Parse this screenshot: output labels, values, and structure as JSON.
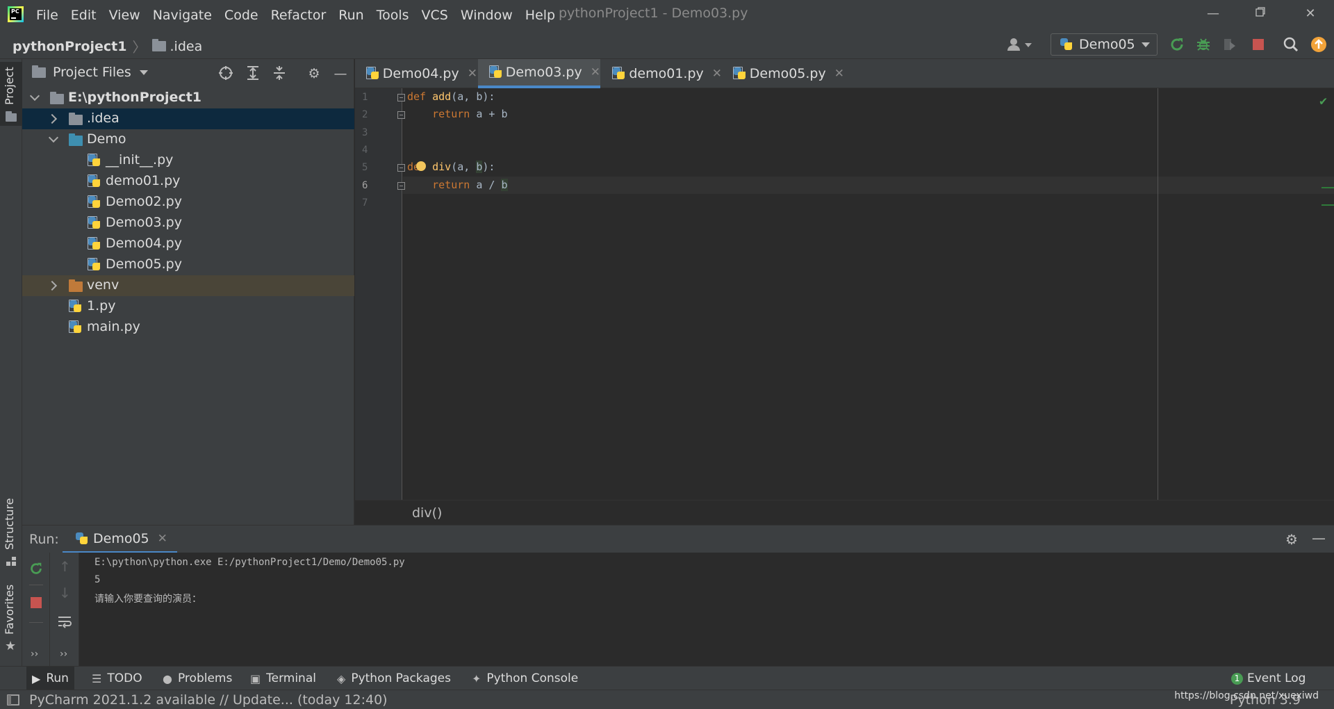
{
  "app": {
    "logo_text": "PC",
    "window_title": "pythonProject1 - Demo03.py",
    "menu": [
      "File",
      "Edit",
      "View",
      "Navigate",
      "Code",
      "Refactor",
      "Run",
      "Tools",
      "VCS",
      "Window",
      "Help"
    ]
  },
  "navbar": {
    "project": "pythonProject1",
    "folder": ".idea",
    "run_config": "Demo05"
  },
  "sidebar_tabs": {
    "project": "Project",
    "structure": "Structure",
    "favorites": "Favorites"
  },
  "project_panel": {
    "title": "Project Files",
    "tree": [
      {
        "label": "E:\\pythonProject1",
        "icon": "folder-icon",
        "expanded": true
      },
      {
        "label": ".idea",
        "icon": "folder-icon",
        "expanded": false,
        "selected": true
      },
      {
        "label": "Demo",
        "icon": "folder-icon",
        "expanded": true
      },
      {
        "label": "__init__.py",
        "icon": "python-file-icon"
      },
      {
        "label": "demo01.py",
        "icon": "python-file-icon"
      },
      {
        "label": "Demo02.py",
        "icon": "python-file-icon"
      },
      {
        "label": "Demo03.py",
        "icon": "python-file-icon"
      },
      {
        "label": "Demo04.py",
        "icon": "python-file-icon"
      },
      {
        "label": "Demo05.py",
        "icon": "python-file-icon"
      },
      {
        "label": "venv",
        "icon": "folder-icon",
        "expanded": false
      },
      {
        "label": "1.py",
        "icon": "python-file-icon"
      },
      {
        "label": "main.py",
        "icon": "python-file-icon"
      }
    ]
  },
  "editor": {
    "tabs": [
      {
        "label": "Demo04.py",
        "active": false
      },
      {
        "label": "Demo03.py",
        "active": true
      },
      {
        "label": "demo01.py",
        "active": false
      },
      {
        "label": "Demo05.py",
        "active": false
      }
    ],
    "line_numbers": [
      "1",
      "2",
      "3",
      "4",
      "5",
      "6",
      "7"
    ],
    "code": {
      "l1_kw": "def",
      "l1_fn": "add",
      "l1_rest": "(a, b):",
      "l2_kw": "return",
      "l2_rest": " a + b",
      "l5_kw": "de",
      "l5_fn": "div",
      "l5_pre": "(a, ",
      "l5_param": "b",
      "l5_post": "):",
      "l6_kw": "return",
      "l6_pre": " a / ",
      "l6_param": "b"
    },
    "breadcrumb": "div()"
  },
  "run_panel": {
    "label": "Run:",
    "tab": "Demo05",
    "console": [
      "E:\\python\\python.exe E:/pythonProject1/Demo/Demo05.py",
      "5",
      "请输入你要查询的演员："
    ]
  },
  "tool_strip": {
    "run": "Run",
    "todo": "TODO",
    "problems": "Problems",
    "terminal": "Terminal",
    "python_packages": "Python Packages",
    "python_console": "Python Console",
    "event_log": "Event Log",
    "event_log_count": "1"
  },
  "status": {
    "message": "PyCharm 2021.1.2 available // Update... (today 12:40)",
    "interpreter": "Python 3.9",
    "watermark": "https://blog.csdn.net/xuexiwd"
  },
  "colors": {
    "accent": "#4a88c7",
    "keyword": "#cc7832",
    "function": "#ffc66d",
    "run_green": "#499c54",
    "stop_red": "#c75450",
    "update_orange": "#f2a33a"
  }
}
